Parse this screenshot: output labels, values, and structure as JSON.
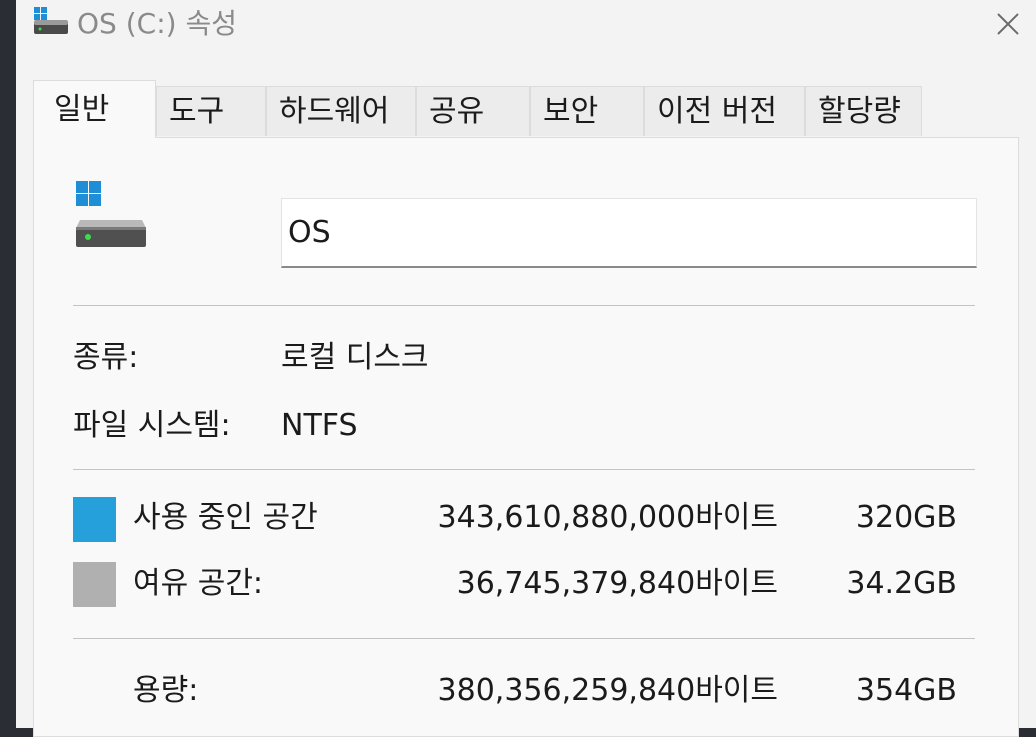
{
  "window": {
    "title": "OS (C:) 속성",
    "close_icon": "close-icon",
    "title_icon": "drive-icon"
  },
  "tabs": [
    {
      "label": "일반",
      "active": true
    },
    {
      "label": "도구"
    },
    {
      "label": "하드웨어"
    },
    {
      "label": "공유"
    },
    {
      "label": "보안"
    },
    {
      "label": "이전 버전"
    },
    {
      "label": "할당량"
    }
  ],
  "general": {
    "drive_icon": "windows-drive-icon",
    "name_value": "OS",
    "type_label": "종류:",
    "type_value": "로컬 디스크",
    "fs_label": "파일 시스템:",
    "fs_value": "NTFS",
    "used": {
      "label": "사용 중인 공간",
      "bytes": "343,610,880,000바이트",
      "size": "320GB",
      "color": "#26a0da"
    },
    "free": {
      "label": "여유 공간:",
      "bytes": "36,745,379,840바이트",
      "size": "34.2GB",
      "color": "#b0b0b0"
    },
    "capacity": {
      "label": "용량:",
      "bytes": "380,356,259,840바이트",
      "size": "354GB"
    }
  }
}
